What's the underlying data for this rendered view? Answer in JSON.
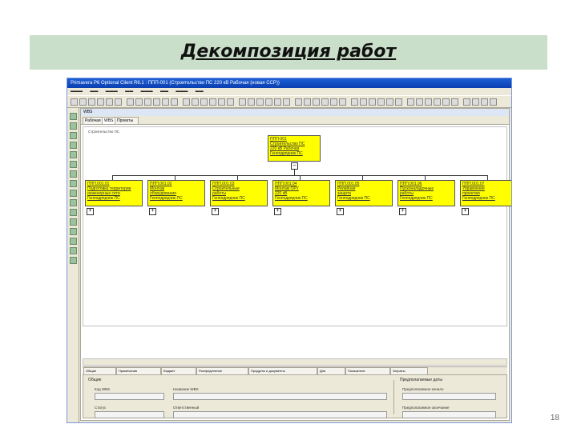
{
  "slide": {
    "title": "Декомпозиция работ",
    "page_number": "18",
    "band_color": "#c9dfc9"
  },
  "app": {
    "window_title": "Primavera P6 Optional Client R6.1 : ППП-001 (Строительство ПС 220 кВ Рабочая (новая ССР))",
    "panel_title": "WBS",
    "tabs": [
      "Рабочая",
      "WBS",
      "Проекты"
    ],
    "active_tab": 1,
    "chart_label": "Строительство ПС",
    "root": {
      "code": "ППП-001",
      "lines": [
        "Строительство ПС",
        "220 кВ Рабочая",
        "Генподрядчик ПС"
      ]
    },
    "children": [
      {
        "code": "ППП.001.01",
        "lines": [
          "Подготовка территории",
          "инженерные сети",
          "Генподрядчик ПС"
        ]
      },
      {
        "code": "ППП.001.02",
        "lines": [
          "Монтаж",
          "оборудования",
          "Генподрядчик ПС"
        ]
      },
      {
        "code": "ППП.001.03",
        "lines": [
          "Строительные",
          "работы",
          "Генподрядчик ПС"
        ]
      },
      {
        "code": "ППП.001.04",
        "lines": [
          "Монтаж ОРУ",
          "220 кВ",
          "Генподрядчик ПС"
        ]
      },
      {
        "code": "ППП.001.05",
        "lines": [
          "Релейная",
          "защита",
          "Генподрядчик ПС"
        ]
      },
      {
        "code": "ППП.001.06",
        "lines": [
          "Пусконаладочные",
          "работы",
          "Генподрядчик ПС"
        ]
      },
      {
        "code": "ППП.001.07",
        "lines": [
          "Управление",
          "проектом",
          "Генподрядчик ПС"
        ]
      }
    ],
    "bottom_tabs": [
      "Общие",
      "Примечания",
      "Бюджет",
      "Распределение",
      "Продукты и документы",
      "Дни",
      "Показатели",
      "Затраты"
    ],
    "detail": {
      "group_general": "Общие",
      "wbs_code_label": "Код WBS",
      "wbs_name_label": "Название WBS",
      "status_label": "Статус",
      "responsible_label": "Ответственный",
      "group_anticipated": "Предполагаемые даты",
      "anticipated_start_label": "Предполагаемое начало",
      "anticipated_finish_label": "Предполагаемое окончание"
    }
  },
  "colors": {
    "node_fill": "#ffff00",
    "titlebar": "#1d5fd6",
    "window_bg": "#ece9d8"
  }
}
